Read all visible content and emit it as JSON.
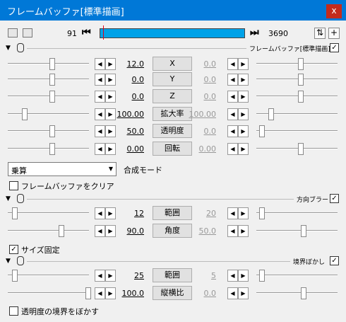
{
  "window": {
    "title": "フレームバッファ[標準描画]",
    "close_label": "x"
  },
  "toolbar": {
    "frame_start": "91",
    "frame_end": "3690",
    "prev_label": "⏮",
    "next_label": "⏭",
    "plus_label": "+",
    "swap_label": "⇅"
  },
  "groups": [
    {
      "label": "フレームバッファ[標準描画]",
      "params": [
        {
          "name": "X",
          "value": "12.0",
          "end": "0.0"
        },
        {
          "name": "Y",
          "value": "0.0",
          "end": "0.0"
        },
        {
          "name": "Z",
          "value": "0.0",
          "end": "0.0"
        },
        {
          "name": "拡大率",
          "value": "100.00",
          "end": "100.00"
        },
        {
          "name": "透明度",
          "value": "50.0",
          "end": "0.0"
        },
        {
          "name": "回転",
          "value": "0.00",
          "end": "0.00"
        }
      ],
      "blend": {
        "value": "乗算",
        "label": "合成モード"
      },
      "checkbox": {
        "label": "フレームバッファをクリア",
        "checked": false
      }
    },
    {
      "label": "方向ブラー",
      "params": [
        {
          "name": "範囲",
          "value": "12",
          "end": "20"
        },
        {
          "name": "角度",
          "value": "90.0",
          "end": "50.0"
        }
      ],
      "checkbox": {
        "label": "サイズ固定",
        "checked": true
      }
    },
    {
      "label": "境界ぼかし",
      "params": [
        {
          "name": "範囲",
          "value": "25",
          "end": "5"
        },
        {
          "name": "縦横比",
          "value": "100.0",
          "end": "0.0"
        }
      ],
      "checkbox": {
        "label": "透明度の境界をぼかす",
        "checked": false
      }
    }
  ],
  "check_mark": "✓",
  "arrows": {
    "left": "◀",
    "right": "▶",
    "dd": "▼"
  }
}
